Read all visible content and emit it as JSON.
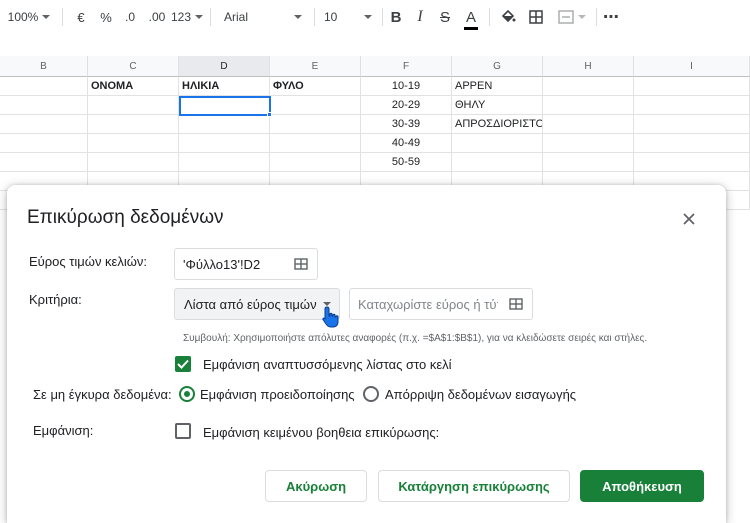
{
  "toolbar": {
    "zoom": "100%",
    "currency": "€",
    "percent": "%",
    "decrease_decimals": ".0",
    "increase_decimals": ".00",
    "number_format": "123",
    "font": "Arial",
    "font_size": "10",
    "bold": "B",
    "italic": "I",
    "strikethrough": "S",
    "text_color": "A",
    "more": "⋯"
  },
  "sheet": {
    "columns": [
      "B",
      "C",
      "D",
      "E",
      "F",
      "G",
      "H",
      "I"
    ],
    "selected_column": "D",
    "headers": {
      "name": "ΟΝΟΜΑ",
      "age": "ΗΛΙΚΙΑ",
      "sex": "ΦΥΛΟ"
    },
    "age_ranges": [
      "10-19",
      "20-29",
      "30-39",
      "40-49",
      "50-59"
    ],
    "sex_values": [
      "ΑΡΡΕΝ",
      "ΘΗΛΥ",
      "ΑΠΡΟΣΔΙΟΡΙΣΤΟ"
    ]
  },
  "dialog": {
    "title": "Επικύρωση δεδομένων",
    "cell_range_label": "Εύρος τιμών κελιών:",
    "cell_range_value": "'Φύλλο13'!D2",
    "criteria_label": "Κριτήρια:",
    "criteria_type": "Λίστα από εύρος τιμών",
    "range_placeholder": "Καταχωρίστε εύρος ή τύπο",
    "hint": "Συμβουλή: Χρησιμοποιήστε απόλυτες αναφορές (π.χ. =$A$1:$B$1), για να κλειδώσετε σειρές και στήλες.",
    "show_dropdown_label": "Εμφάνιση αναπτυσσόμενης λίστας στο κελί",
    "show_dropdown_checked": true,
    "invalid_label": "Σε μη έγκυρα δεδομένα:",
    "invalid_options": [
      "Εμφάνιση προειδοποίησης",
      "Απόρριψη δεδομένων εισαγωγής"
    ],
    "invalid_selected": "Εμφάνιση προειδοποίησης",
    "appearance_label": "Εμφάνιση:",
    "help_text_label": "Εμφάνιση κειμένου βοηθεια επικύρωσης:",
    "help_text_checked": false,
    "cancel": "Ακύρωση",
    "remove": "Κατάργηση επικύρωσης",
    "save": "Αποθήκευση"
  },
  "colors": {
    "accent": "#188038",
    "selection": "#1a73e8"
  }
}
